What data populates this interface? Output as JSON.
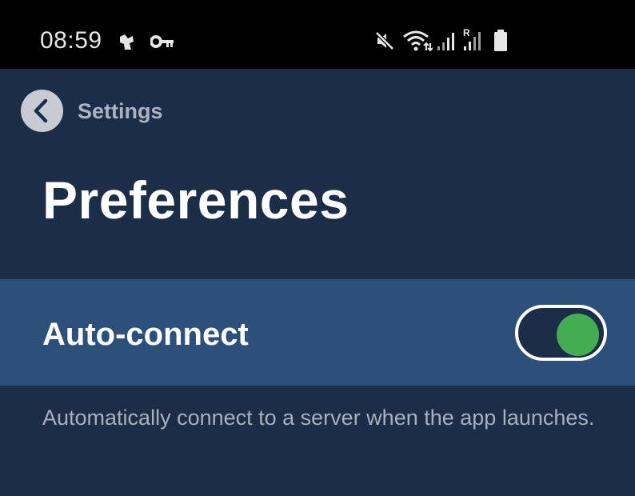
{
  "status_bar": {
    "time": "08:59",
    "left_icons": [
      "notification-icon",
      "vpn-key-icon"
    ],
    "right_icons": [
      "mute-icon",
      "wifi-icon",
      "signal-icon",
      "roaming-signal-icon",
      "battery-icon"
    ],
    "roaming_label": "R"
  },
  "nav": {
    "back_icon": "chevron-left-icon",
    "back_label": "Settings"
  },
  "page": {
    "title": "Preferences"
  },
  "preferences": [
    {
      "label": "Auto-connect",
      "enabled": true,
      "description": "Automatically connect to a server when the app launches."
    }
  ],
  "colors": {
    "background": "#1c2d48",
    "row_highlight": "#2c5079",
    "toggle_on": "#44ad54",
    "status_bar": "#000000"
  }
}
